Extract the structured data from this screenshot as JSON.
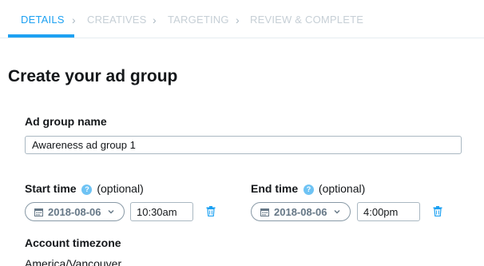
{
  "steps": [
    {
      "label": "DETAILS",
      "active": true
    },
    {
      "label": "CREATIVES",
      "active": false
    },
    {
      "label": "TARGETING",
      "active": false
    },
    {
      "label": "REVIEW & COMPLETE",
      "active": false
    }
  ],
  "page_title": "Create your ad group",
  "ad_group_name": {
    "label": "Ad group name",
    "value": "Awareness ad group 1"
  },
  "start_time": {
    "label": "Start time",
    "help_icon": "question-mark-icon",
    "optional": "(optional)",
    "date": "2018-08-06",
    "time": "10:30am"
  },
  "end_time": {
    "label": "End time",
    "help_icon": "question-mark-icon",
    "optional": "(optional)",
    "date": "2018-08-06",
    "time": "4:00pm"
  },
  "account_timezone": {
    "label": "Account timezone",
    "value": "America/Vancouver"
  },
  "colors": {
    "accent": "#1da1f2",
    "inactive_step": "#c6cfd6",
    "text": "#14171a",
    "help_icon_bg": "#6ec3f4"
  }
}
